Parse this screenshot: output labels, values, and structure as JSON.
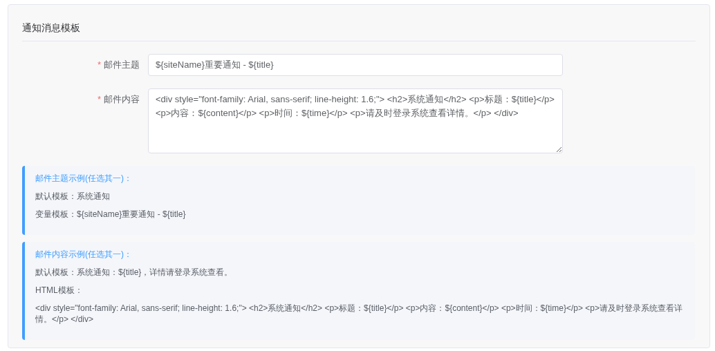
{
  "card": {
    "title": "通知消息模板"
  },
  "fields": [
    {
      "kind": "input",
      "required_mark": "*",
      "label": "邮件主题",
      "value": "${siteName}重要通知 - ${title}"
    },
    {
      "kind": "textarea",
      "required_mark": "*",
      "label": "邮件内容",
      "value": "<div style=\"font-family: Arial, sans-serif; line-height: 1.6;\"> <h2>系统通知</h2> <p>标题：${title}</p> <p>内容：${content}</p> <p>时间：${time}</p> <p>请及时登录系统查看详情。</p> </div>"
    }
  ],
  "tips": [
    {
      "heading": "邮件主题示例(任选其一)：",
      "lines": [
        "默认模板：系统通知",
        "变量模板：${siteName}重要通知 - ${title}"
      ]
    },
    {
      "heading": "邮件内容示例(任选其一)：",
      "lines": [
        "默认模板：系统通知：${title}，详情请登录系统查看。",
        "HTML模板：",
        "<div style=\"font-family: Arial, sans-serif; line-height: 1.6;\"> <h2>系统通知</h2> <p>标题：${title}</p> <p>内容：${content}</p> <p>时间：${time}</p> <p>请及时登录系统查看详情。</p> </div>"
      ]
    }
  ]
}
